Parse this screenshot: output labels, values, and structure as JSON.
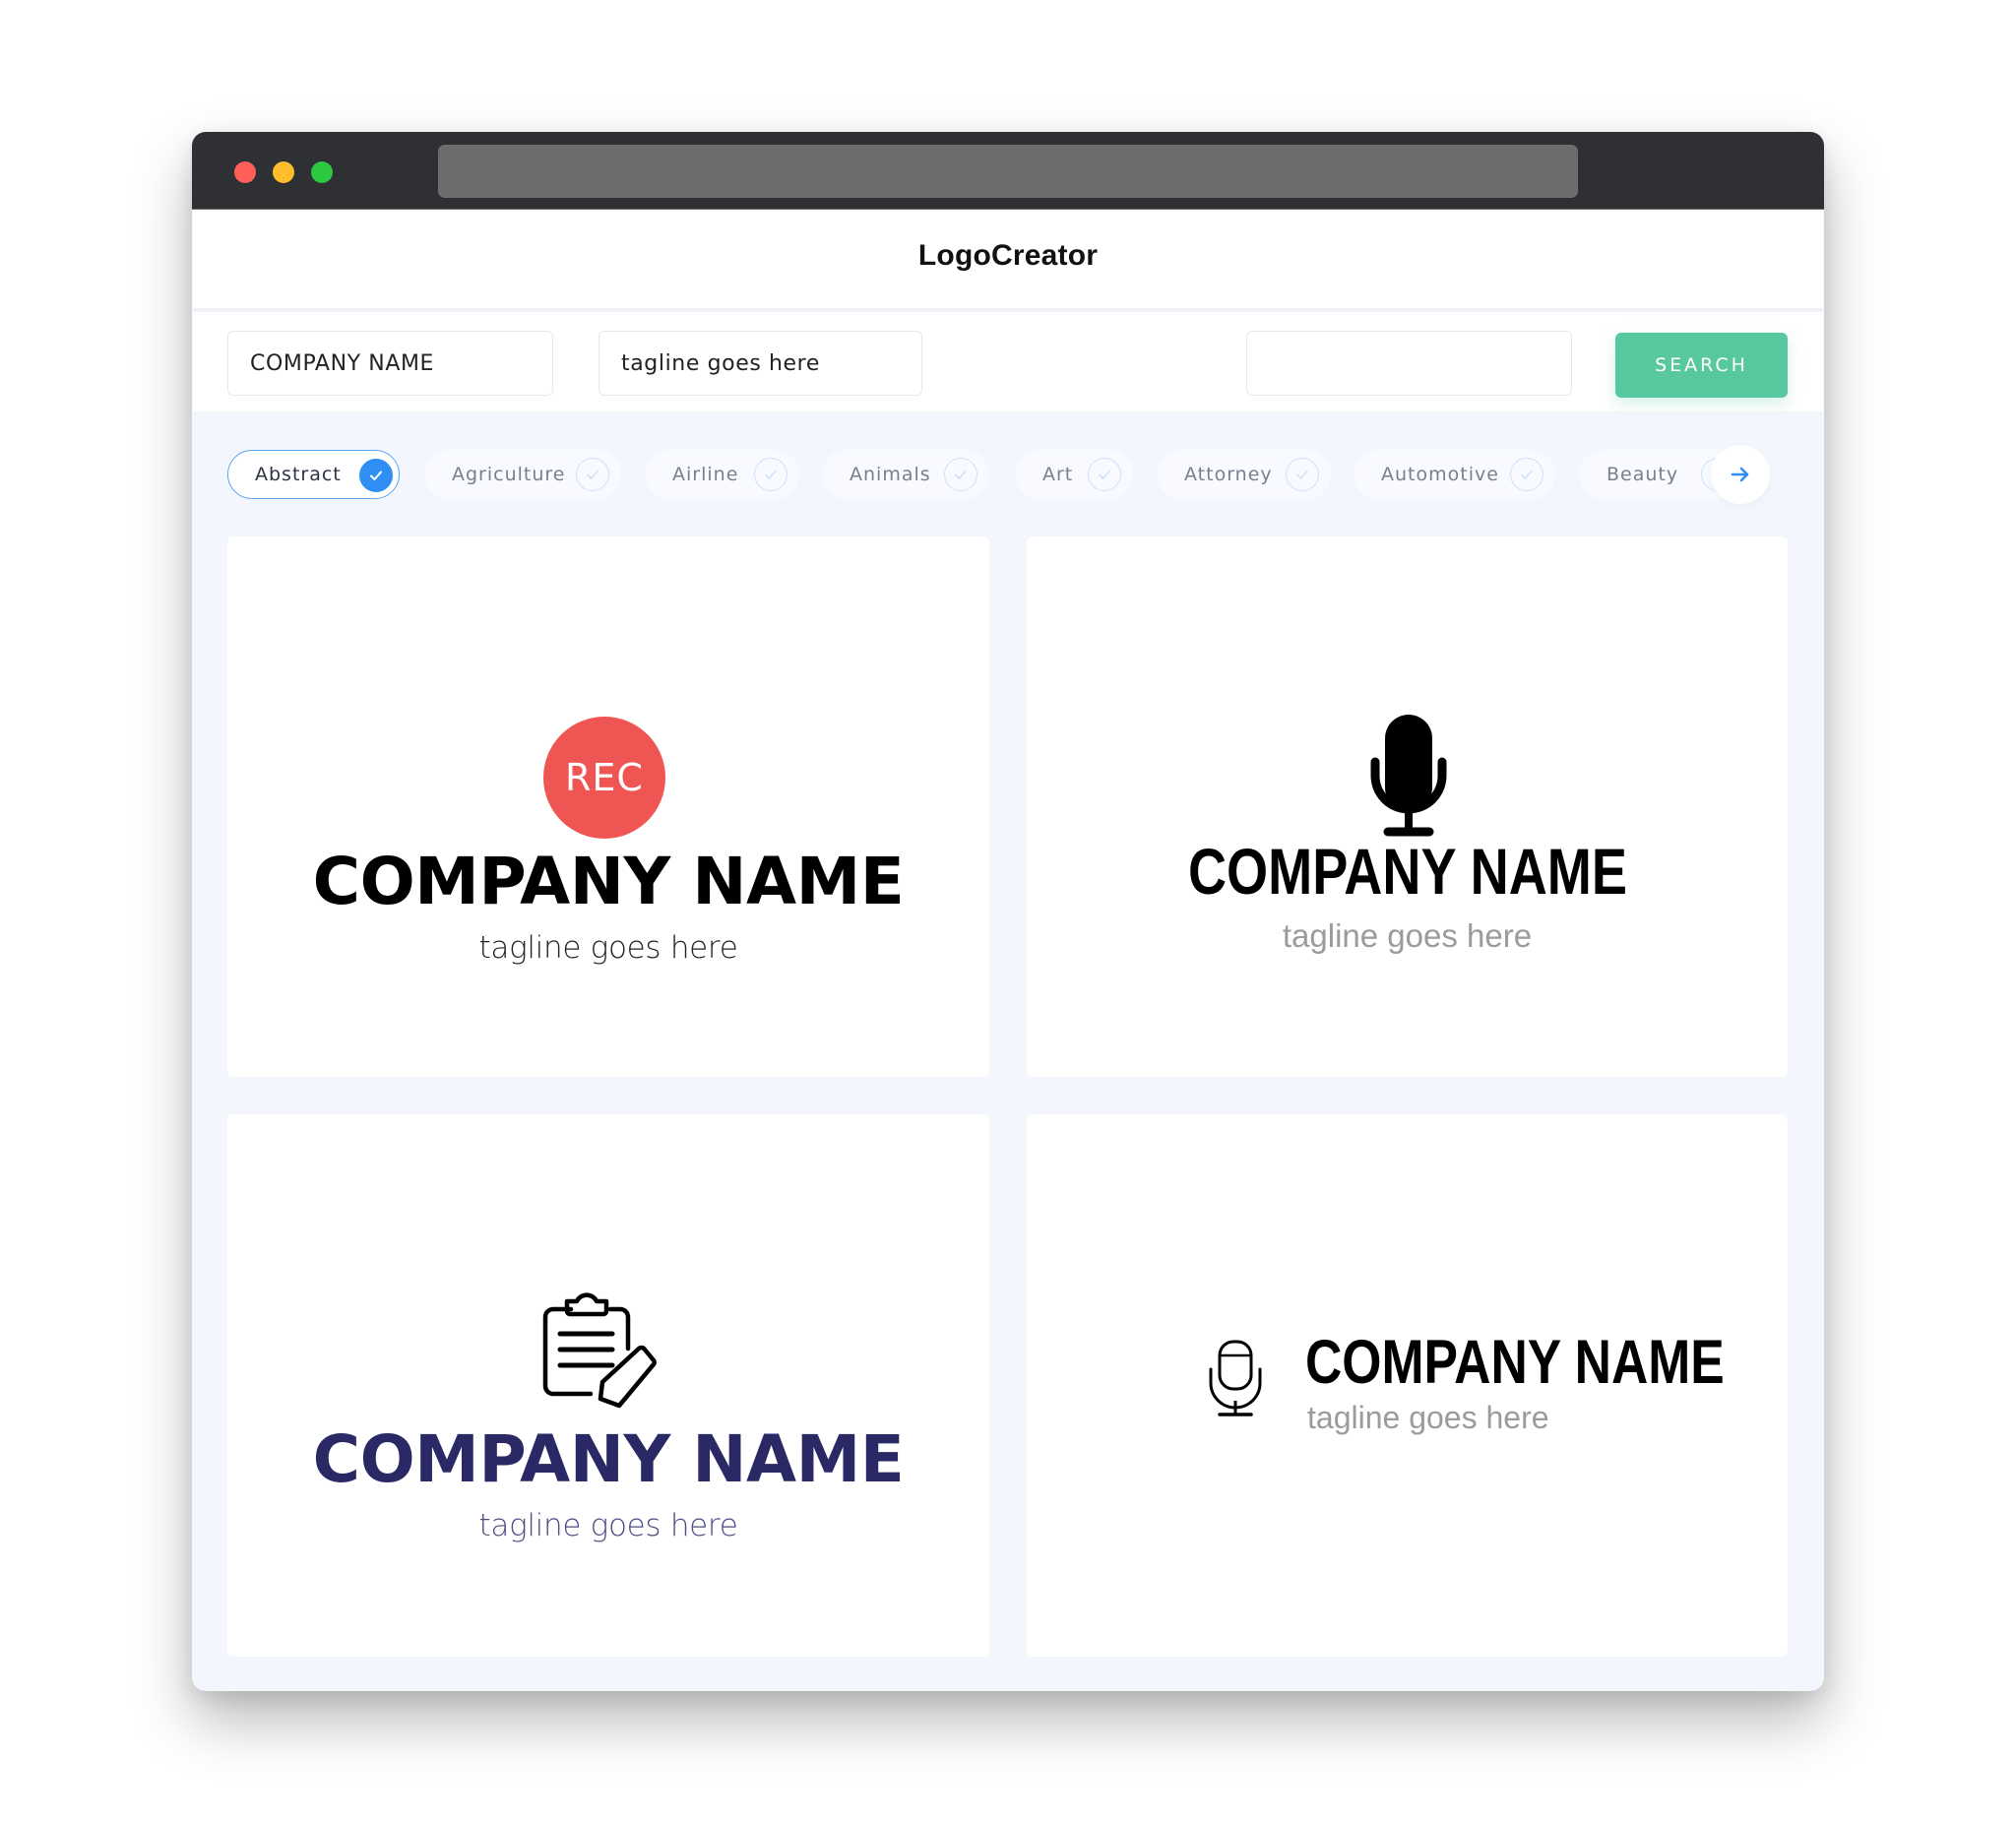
{
  "app": {
    "title": "LogoCreator"
  },
  "window_controls": [
    "close",
    "minimize",
    "maximize"
  ],
  "search": {
    "company_name_value": "COMPANY NAME",
    "tagline_value": "tagline goes here",
    "keyword_value": "",
    "button_label": "SEARCH",
    "button_color": "#58c99e"
  },
  "categories": {
    "items": [
      {
        "label": "Abstract",
        "selected": true
      },
      {
        "label": "Agriculture",
        "selected": false
      },
      {
        "label": "Airline",
        "selected": false
      },
      {
        "label": "Animals",
        "selected": false
      },
      {
        "label": "Art",
        "selected": false
      },
      {
        "label": "Attorney",
        "selected": false
      },
      {
        "label": "Automotive",
        "selected": false
      },
      {
        "label": "Beauty",
        "selected": false
      }
    ],
    "next_icon": "arrow-right-icon",
    "accent_color": "#2f8ff5"
  },
  "logos": [
    {
      "icon": "rec-badge-icon",
      "badge_text": "REC",
      "badge_color": "#ef5552",
      "company_name": "COMPANY NAME",
      "tagline": "tagline goes here",
      "name_color": "#000000",
      "tagline_color": "#222222",
      "layout": "stacked"
    },
    {
      "icon": "microphone-icon",
      "company_name": "COMPANY NAME",
      "tagline": "tagline goes here",
      "name_color": "#000000",
      "tagline_color": "#9b9b9b",
      "layout": "stacked"
    },
    {
      "icon": "clipboard-pencil-icon",
      "company_name": "COMPANY NAME",
      "tagline": "tagline goes here",
      "name_color": "#2a2966",
      "tagline_color": "#4e4d85",
      "layout": "stacked"
    },
    {
      "icon": "microphone-outline-icon",
      "company_name": "COMPANY NAME",
      "tagline": "tagline goes here",
      "name_color": "#000000",
      "tagline_color": "#9b9b9b",
      "layout": "horizontal"
    }
  ]
}
